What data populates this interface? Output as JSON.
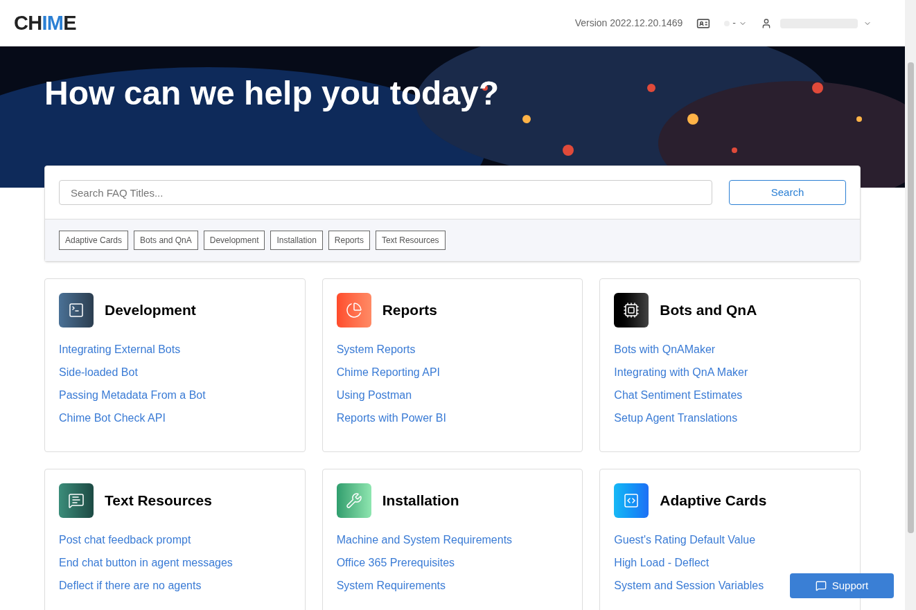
{
  "header": {
    "logo": [
      {
        "text": "CH",
        "accent": false
      },
      {
        "text": "IM",
        "accent": true
      },
      {
        "text": "E",
        "accent": false
      }
    ],
    "version": "Version 2022.12.20.1469",
    "status_text": "-"
  },
  "hero": {
    "title": "How can we help you today?"
  },
  "search": {
    "placeholder": "Search FAQ Titles...",
    "button": "Search"
  },
  "tags": [
    "Adaptive Cards",
    "Bots and QnA",
    "Development",
    "Installation",
    "Reports",
    "Text Resources"
  ],
  "categories": [
    {
      "kind": "terminal",
      "title": "Development",
      "links": [
        "Integrating External Bots",
        "Side-loaded Bot",
        "Passing Metadata From a Bot",
        "Chime Bot Check API"
      ]
    },
    {
      "kind": "chart",
      "title": "Reports",
      "links": [
        "System Reports",
        "Chime Reporting API",
        "Using Postman",
        "Reports with Power BI"
      ]
    },
    {
      "kind": "chip",
      "title": "Bots and QnA",
      "links": [
        "Bots with QnAMaker",
        "Integrating with QnA Maker",
        "Chat Sentiment Estimates",
        "Setup Agent Translations"
      ]
    },
    {
      "kind": "message",
      "title": "Text Resources",
      "links": [
        "Post chat feedback prompt",
        "End chat button in agent messages",
        "Deflect if there are no agents"
      ]
    },
    {
      "kind": "tools",
      "title": "Installation",
      "links": [
        "Machine and System Requirements",
        "Office 365 Prerequisites",
        "System Requirements"
      ]
    },
    {
      "kind": "code",
      "title": "Adaptive Cards",
      "links": [
        "Guest's Rating Default Value",
        "High Load - Deflect",
        "System and Session Variables"
      ]
    }
  ],
  "support_button": "Support"
}
